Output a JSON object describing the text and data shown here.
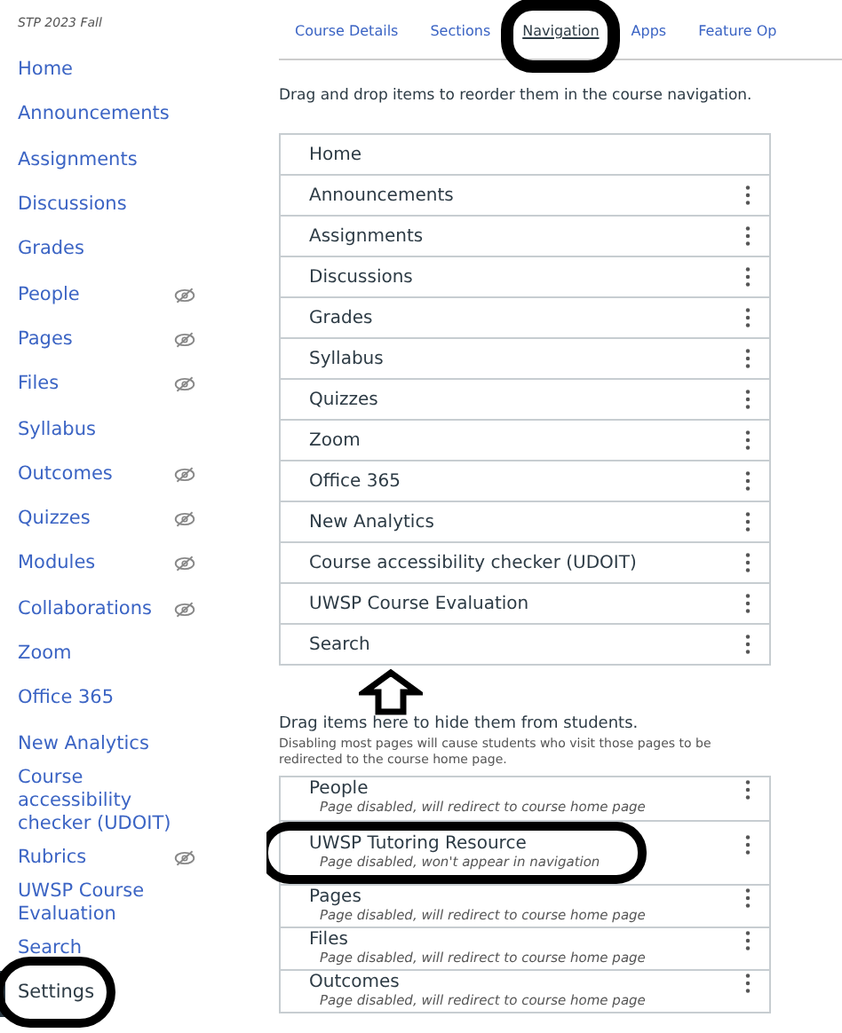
{
  "course_term": "STP 2023 Fall",
  "sidebar": {
    "items": [
      {
        "label": "Home",
        "hidden": false,
        "selected": false
      },
      {
        "label": "Announcements",
        "hidden": false,
        "selected": false
      },
      {
        "label": "Assignments",
        "hidden": false,
        "selected": false
      },
      {
        "label": "Discussions",
        "hidden": false,
        "selected": false
      },
      {
        "label": "Grades",
        "hidden": false,
        "selected": false
      },
      {
        "label": "People",
        "hidden": true,
        "selected": false
      },
      {
        "label": "Pages",
        "hidden": true,
        "selected": false
      },
      {
        "label": "Files",
        "hidden": true,
        "selected": false
      },
      {
        "label": "Syllabus",
        "hidden": false,
        "selected": false
      },
      {
        "label": "Outcomes",
        "hidden": true,
        "selected": false
      },
      {
        "label": "Quizzes",
        "hidden": true,
        "selected": false
      },
      {
        "label": "Modules",
        "hidden": true,
        "selected": false
      },
      {
        "label": "Collaborations",
        "hidden": true,
        "selected": false
      },
      {
        "label": "Zoom",
        "hidden": false,
        "selected": false
      },
      {
        "label": "Office 365",
        "hidden": false,
        "selected": false
      },
      {
        "label": "New Analytics",
        "hidden": false,
        "selected": false
      },
      {
        "label": "Course accessibility checker (UDOIT)",
        "hidden": false,
        "selected": false
      },
      {
        "label": "Rubrics",
        "hidden": true,
        "selected": false
      },
      {
        "label": "UWSP Course Evaluation",
        "hidden": false,
        "selected": false
      },
      {
        "label": "Search",
        "hidden": false,
        "selected": false
      },
      {
        "label": "Settings",
        "hidden": false,
        "selected": true,
        "circled": true
      }
    ]
  },
  "tabs": [
    {
      "label": "Course Details",
      "selected": false,
      "circled": false
    },
    {
      "label": "Sections",
      "selected": false,
      "circled": false
    },
    {
      "label": "Navigation",
      "selected": true,
      "circled": true
    },
    {
      "label": "Apps",
      "selected": false,
      "circled": false
    },
    {
      "label": "Feature Op",
      "selected": false,
      "circled": false
    }
  ],
  "instructions": "Drag and drop items to reorder them in the course navigation.",
  "enabled_items": [
    {
      "label": "Home",
      "menu": false
    },
    {
      "label": "Announcements",
      "menu": true
    },
    {
      "label": "Assignments",
      "menu": true
    },
    {
      "label": "Discussions",
      "menu": true
    },
    {
      "label": "Grades",
      "menu": true
    },
    {
      "label": "Syllabus",
      "menu": true
    },
    {
      "label": "Quizzes",
      "menu": true
    },
    {
      "label": "Zoom",
      "menu": true
    },
    {
      "label": "Office 365",
      "menu": true
    },
    {
      "label": "New Analytics",
      "menu": true
    },
    {
      "label": "Course accessibility checker (UDOIT)",
      "menu": true
    },
    {
      "label": "UWSP Course Evaluation",
      "menu": true
    },
    {
      "label": "Search",
      "menu": true
    }
  ],
  "hidden_section": {
    "heading": "Drag items here to hide them from students.",
    "hint": "Disabling most pages will cause students who visit those pages to be redirected to the course home page."
  },
  "disabled_items": [
    {
      "label": "People",
      "note": "Page disabled, will redirect to course home page",
      "menu": true,
      "circled": false
    },
    {
      "label": "UWSP Tutoring Resource",
      "note": "Page disabled, won't appear in navigation",
      "menu": true,
      "circled": true
    },
    {
      "label": "Pages",
      "note": "Page disabled, will redirect to course home page",
      "menu": true,
      "circled": false
    },
    {
      "label": "Files",
      "note": "Page disabled, will redirect to course home page",
      "menu": true,
      "circled": false
    },
    {
      "label": "Outcomes",
      "note": "Page disabled, will redirect to course home page",
      "menu": true,
      "circled": false
    }
  ]
}
